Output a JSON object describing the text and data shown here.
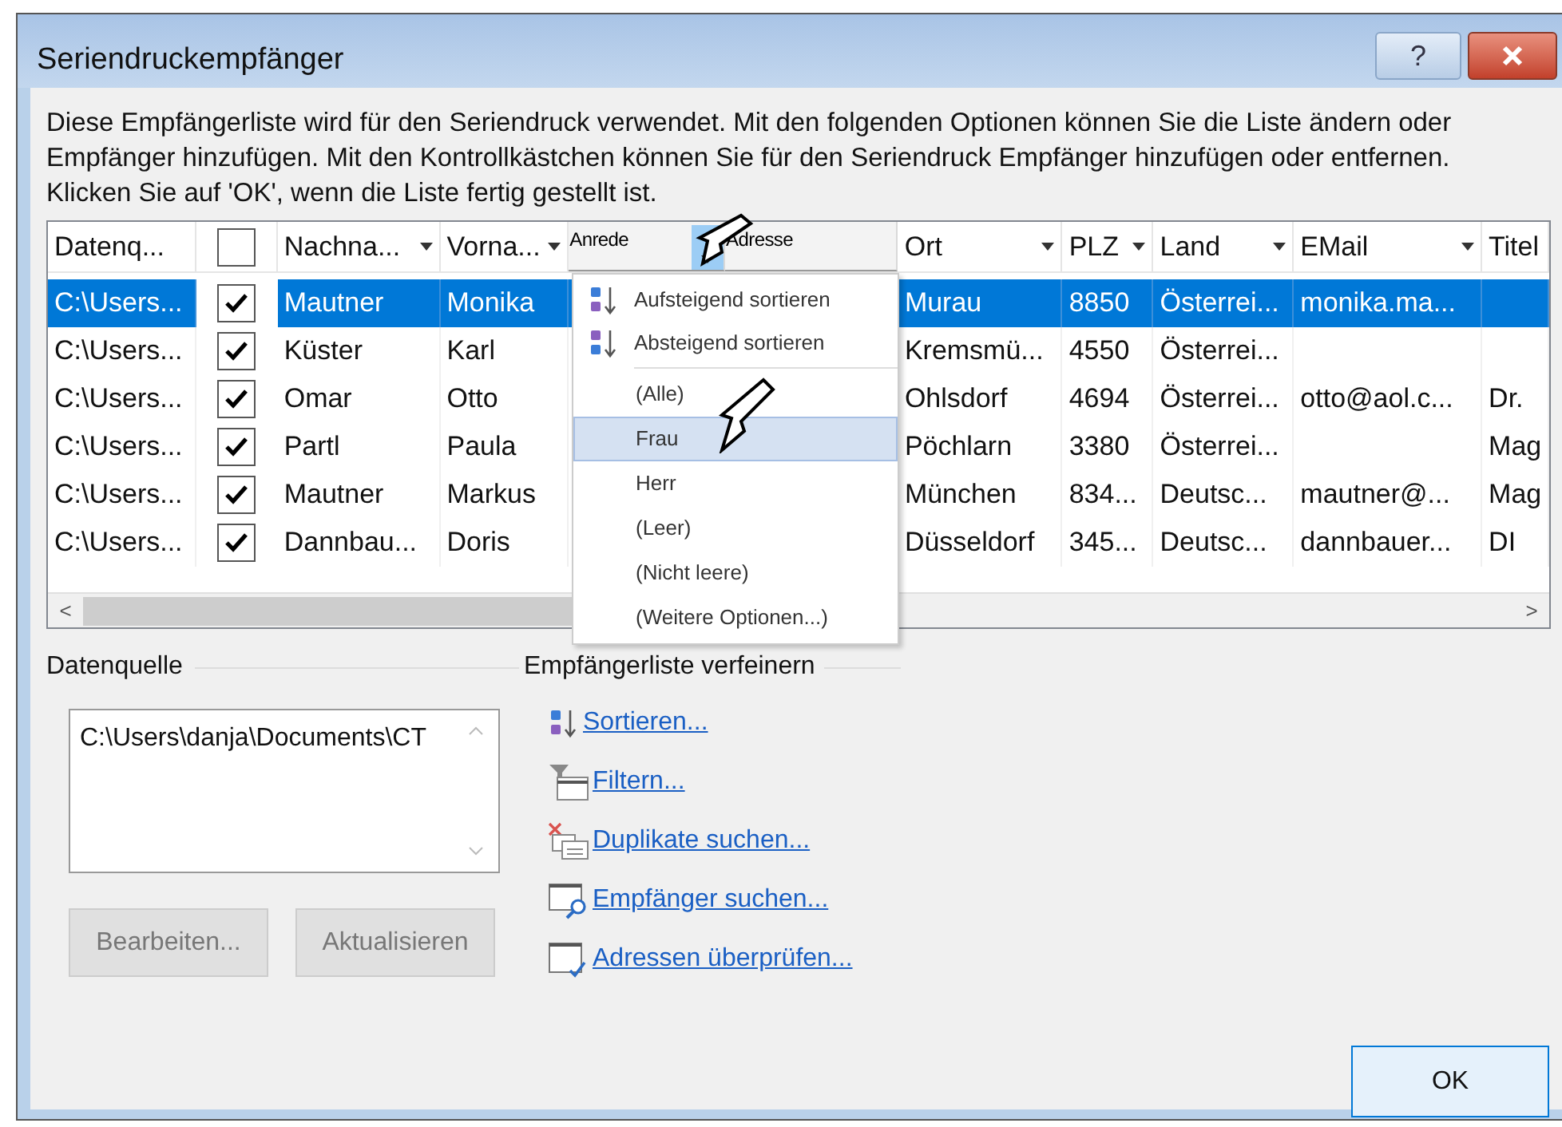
{
  "window": {
    "title": "Seriendruckempfänger",
    "help_label": "?"
  },
  "description": "Diese Empfängerliste wird für den Seriendruck verwendet. Mit den folgenden Optionen können Sie die Liste ändern oder Empfänger hinzufügen. Mit den Kontrollkästchen können Sie für den Seriendruck Empfänger hinzufügen oder entfernen. Klicken Sie auf 'OK', wenn die Liste fertig gestellt ist.",
  "table": {
    "columns": [
      {
        "label": "Datenq...",
        "kind": "text",
        "filter": false
      },
      {
        "kind": "checkbox",
        "checked": false
      },
      {
        "label": "Nachna...",
        "kind": "text",
        "filter": true
      },
      {
        "label": "Vorna...",
        "kind": "text",
        "filter": true
      },
      {
        "label": "Anrede",
        "kind": "small",
        "filter": true,
        "dropdown_open": true
      },
      {
        "label": "Adresse",
        "kind": "small",
        "filter": false
      },
      {
        "label": "Ort",
        "kind": "text",
        "filter": true
      },
      {
        "label": "PLZ",
        "kind": "text",
        "filter": true
      },
      {
        "label": "Land",
        "kind": "text",
        "filter": true
      },
      {
        "label": "EMail",
        "kind": "text",
        "filter": true
      },
      {
        "label": "Titel",
        "kind": "text",
        "filter": false
      }
    ],
    "rows": [
      {
        "selected": true,
        "checked": true,
        "source": "C:\\Users...",
        "last_name": "Mautner",
        "first_name": "Monika",
        "city": "Murau",
        "zip": "8850",
        "country": "Österrei...",
        "email": "monika.ma..."
      },
      {
        "selected": false,
        "checked": true,
        "source": "C:\\Users...",
        "last_name": "Küster",
        "first_name": "Karl",
        "city": "Kremsmü...",
        "zip": "4550",
        "country": "Österrei..."
      },
      {
        "selected": false,
        "checked": true,
        "source": "C:\\Users...",
        "last_name": "Omar",
        "first_name": "Otto",
        "city": "Ohlsdorf",
        "zip": "4694",
        "country": "Österrei...",
        "email": "otto@aol.c...",
        "title": "Dr."
      },
      {
        "selected": false,
        "checked": true,
        "source": "C:\\Users...",
        "last_name": "Partl",
        "first_name": "Paula",
        "city": "Pöchlarn",
        "zip": "3380",
        "country": "Österrei...",
        "title": "Mag"
      },
      {
        "selected": false,
        "checked": true,
        "source": "C:\\Users...",
        "last_name": "Mautner",
        "first_name": "Markus",
        "city": "München",
        "zip": "834...",
        "country": "Deutsc...",
        "email": "mautner@...",
        "title": "Mag"
      },
      {
        "selected": false,
        "checked": true,
        "source": "C:\\Users...",
        "last_name": "Dannbau...",
        "first_name": "Doris",
        "city": "Düsseldorf",
        "zip": "345...",
        "country": "Deutsc...",
        "email": "dannbauer...",
        "title": "DI"
      }
    ],
    "scroll_left": "<",
    "scroll_right": ">"
  },
  "filter_menu": {
    "sort_items": [
      {
        "label": "Aufsteigend sortieren",
        "kind": "ascending"
      },
      {
        "label": "Absteigend sortieren",
        "kind": "descending"
      }
    ],
    "values": [
      {
        "label": "(Alle)",
        "selected": false
      },
      {
        "label": "Frau",
        "selected": true
      },
      {
        "label": "Herr",
        "selected": false
      },
      {
        "label": "(Leer)",
        "selected": false
      },
      {
        "label": "(Nicht leere)",
        "selected": false
      },
      {
        "label": "(Weitere Optionen...)",
        "selected": false
      }
    ]
  },
  "data_source": {
    "title": "Datenquelle",
    "items": [
      "C:\\Users\\danja\\Documents\\CT"
    ],
    "buttons": [
      {
        "label": "Bearbeiten...",
        "disabled": true
      },
      {
        "label": "Aktualisieren",
        "disabled": true
      }
    ]
  },
  "refine": {
    "title": "Empfängerliste verfeinern",
    "links": [
      {
        "label": "Sortieren...",
        "kind": "sort"
      },
      {
        "label": "Filtern...",
        "kind": "filter"
      },
      {
        "label": "Duplikate suchen...",
        "kind": "duplicates"
      },
      {
        "label": "Empfänger suchen...",
        "kind": "find"
      },
      {
        "label": "Adressen überprüfen...",
        "kind": "validate"
      }
    ]
  },
  "ok_button": "OK"
}
